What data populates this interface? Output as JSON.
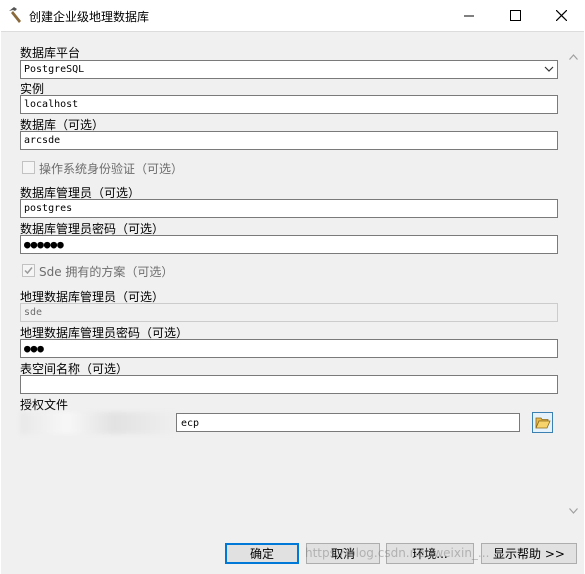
{
  "window": {
    "title": "创建企业级地理数据库"
  },
  "form": {
    "platform_label": "数据库平台",
    "platform_value": "PostgreSQL",
    "instance_label": "实例",
    "instance_value": "localhost",
    "database_label": "数据库（可选）",
    "database_value": "arcsde",
    "os_auth_label": "操作系统身份验证（可选）",
    "os_auth_checked": false,
    "db_admin_label": "数据库管理员（可选）",
    "db_admin_value": "postgres",
    "db_admin_password_label": "数据库管理员密码（可选）",
    "db_admin_password_mask": "●●●●●●",
    "sde_schema_label": "Sde 拥有的方案（可选）",
    "sde_schema_checked": true,
    "gdb_admin_label": "地理数据库管理员（可选）",
    "gdb_admin_value": "sde",
    "gdb_admin_password_label": "地理数据库管理员密码（可选）",
    "gdb_admin_password_mask": "●●●",
    "tablespace_label": "表空间名称（可选）",
    "tablespace_value": "",
    "license_label": "授权文件",
    "license_value": "ecp"
  },
  "buttons": {
    "ok": "确定",
    "cancel": "取消",
    "environments": "环境...",
    "show_help": "显示帮助 >>"
  },
  "watermark": "https://blog.csdn.net/weixin_..."
}
